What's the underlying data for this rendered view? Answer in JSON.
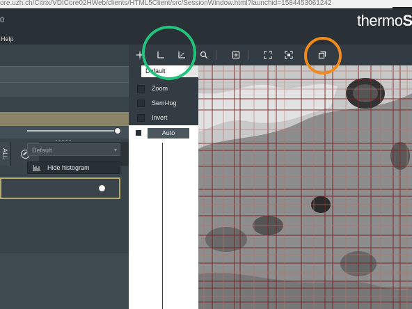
{
  "browser": {
    "url": "ore.uzh.ch/Citrix/VDICore02HWeb/clients/HTML5Client/src/SessionWindow.html?launchid=1584453061242"
  },
  "app": {
    "title_fragment": "0",
    "brand_prefix": "thermo",
    "brand_suffix": "Sc",
    "menu_help": "Help"
  },
  "toolbar": {
    "icons": [
      "plus-icon",
      "axis-linear-icon",
      "axis-log-icon",
      "zoom-icon",
      "zoom-box-icon",
      "fit-icon",
      "fit-frame-icon",
      "popout-icon"
    ]
  },
  "histogram_popup": {
    "tab_label": "Default",
    "options": [
      {
        "label": "Zoom",
        "checked": false
      },
      {
        "label": "Semi-log",
        "checked": false
      },
      {
        "label": "Invert",
        "checked": false
      }
    ],
    "auto_label": "Auto"
  },
  "left_panel": {
    "tab1_label": "ALL",
    "dropdown_value": "Default",
    "histogram_button": "Hide histogram"
  },
  "annotations": {
    "green_color": "#22c47d",
    "orange_color": "#f08a1c"
  }
}
